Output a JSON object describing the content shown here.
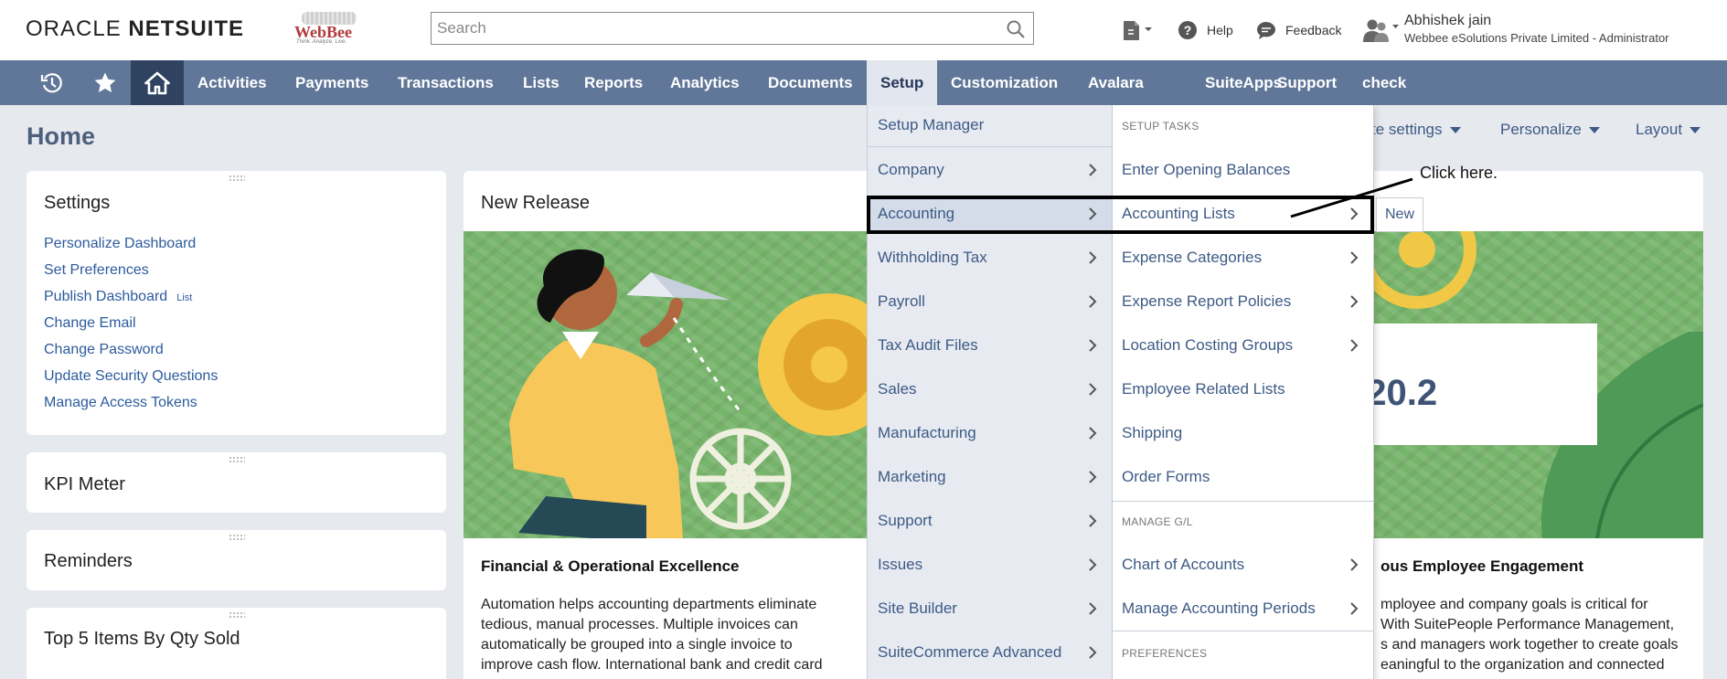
{
  "header": {
    "logo_oracle": "ORACLE",
    "logo_netsuite": "NETSUITE",
    "webbee_logo": "WebBee",
    "webbee_tagline": "Think. Analyze. Live.",
    "search_placeholder": "Search",
    "help_label": "Help",
    "feedback_label": "Feedback",
    "user_name": "Abhishek jain",
    "user_role": "Webbee eSolutions Private Limited - Administrator"
  },
  "nav": {
    "items": [
      "Activities",
      "Payments",
      "Transactions",
      "Lists",
      "Reports",
      "Analytics",
      "Documents",
      "Setup",
      "Customization",
      "Avalara",
      "SuiteApps",
      "Support",
      "check"
    ],
    "active": "Setup"
  },
  "page": {
    "title": "Home",
    "controls": {
      "site_settings": "te settings",
      "personalize": "Personalize",
      "layout": "Layout"
    }
  },
  "settings_portlet": {
    "title": "Settings",
    "links": [
      "Personalize Dashboard",
      "Set Preferences",
      "Publish Dashboard",
      "Change Email",
      "Change Password",
      "Update Security Questions",
      "Manage Access Tokens"
    ],
    "publish_badge": "List"
  },
  "portlets": {
    "kpi": "KPI Meter",
    "reminders": "Reminders",
    "top5": "Top 5 Items By Qty Sold"
  },
  "release": {
    "title": "New Release",
    "version": "020.2",
    "left_head": "Financial & Operational Excellence",
    "left_text": [
      "Automation helps accounting departments eliminate",
      "tedious, manual processes. Multiple invoices can",
      "automatically be grouped into a single invoice to",
      "improve cash flow. International bank and credit card"
    ],
    "right_head": "ous Employee Engagement",
    "right_text": [
      "mployee and company goals is critical for",
      "With SuitePeople Performance Management,",
      "s and managers work together to create goals",
      "eaningful to the organization and connected"
    ]
  },
  "setup_menu": {
    "left": [
      "Setup Manager",
      "Company",
      "Accounting",
      "Withholding Tax",
      "Payroll",
      "Tax Audit Files",
      "Sales",
      "Manufacturing",
      "Marketing",
      "Support",
      "Issues",
      "Site Builder",
      "SuiteCommerce Advanced"
    ],
    "right_sections": {
      "tasks": "SETUP TASKS",
      "gl": "MANAGE G/L",
      "prefs": "PREFERENCES"
    },
    "right": [
      "Enter Opening Balances",
      "Accounting Lists",
      "Expense Categories",
      "Expense Report Policies",
      "Location Costing Groups",
      "Employee Related Lists",
      "Shipping",
      "Order Forms",
      "Chart of Accounts",
      "Manage Accounting Periods"
    ],
    "submenu_new": "New"
  },
  "annotation": {
    "text": "Click here."
  },
  "colors": {
    "nav_bg": "#607799",
    "nav_home": "#2f4361",
    "link": "#2c5b9c",
    "banner": "#78b56c"
  }
}
